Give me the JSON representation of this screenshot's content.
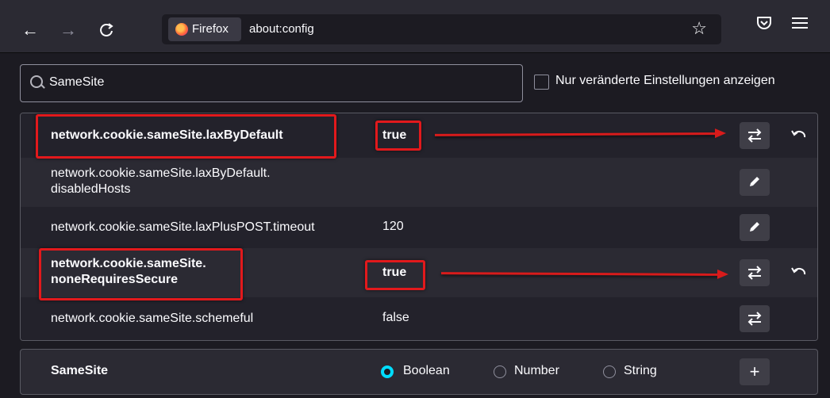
{
  "browser": {
    "identity_label": "Firefox",
    "url": "about:config"
  },
  "search": {
    "value": "SameSite"
  },
  "filter": {
    "checkbox_label": "Nur veränderte Einstellungen anzeigen",
    "checked": false
  },
  "prefs": [
    {
      "name": "network.cookie.sameSite.laxByDefault",
      "value": "true",
      "modified": true,
      "action": "toggle"
    },
    {
      "name_line1": "network.cookie.sameSite.laxByDefault.",
      "name_line2": "disabledHosts",
      "value": "",
      "modified": false,
      "action": "edit"
    },
    {
      "name": "network.cookie.sameSite.laxPlusPOST.timeout",
      "value": "120",
      "modified": false,
      "action": "edit"
    },
    {
      "name_line1": "network.cookie.sameSite.",
      "name_line2": "noneRequiresSecure",
      "value": "true",
      "modified": true,
      "action": "toggle"
    },
    {
      "name": "network.cookie.sameSite.schemeful",
      "value": "false",
      "modified": false,
      "action": "toggle"
    }
  ],
  "add": {
    "name": "SameSite",
    "types": [
      "Boolean",
      "Number",
      "String"
    ],
    "selected": "Boolean"
  },
  "colors": {
    "highlight": "#e2191c",
    "radio_accent": "#00ddff"
  }
}
